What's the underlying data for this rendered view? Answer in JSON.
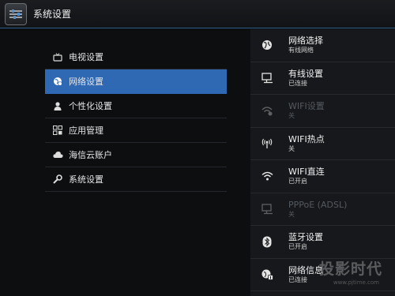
{
  "window": {
    "title": "系统设置",
    "icon": "settings-sliders-icon"
  },
  "menu": {
    "items": [
      {
        "label": "电视设置",
        "icon": "tv-icon"
      },
      {
        "label": "网络设置",
        "icon": "network-globe-icon",
        "active": true
      },
      {
        "label": "个性化设置",
        "icon": "person-icon"
      },
      {
        "label": "应用管理",
        "icon": "apps-grid-icon"
      },
      {
        "label": "海信云账户",
        "icon": "cloud-icon"
      },
      {
        "label": "系统设置",
        "icon": "wrench-icon"
      }
    ]
  },
  "network": {
    "items": [
      {
        "title": "网络选择",
        "status": "有线网络",
        "icon": "globe-icon",
        "enabled": true
      },
      {
        "title": "有线设置",
        "status": "已连接",
        "icon": "wired-monitor-icon",
        "enabled": true
      },
      {
        "title": "WIFI设置",
        "status": "关",
        "icon": "wifi-gear-icon",
        "enabled": false
      },
      {
        "title": "WIFI热点",
        "status": "关",
        "icon": "hotspot-icon",
        "enabled": true
      },
      {
        "title": "WIFI直连",
        "status": "已开启",
        "icon": "wifi-icon",
        "enabled": true
      },
      {
        "title": "PPPoE (ADSL)",
        "status": "关",
        "icon": "pppoe-monitor-icon",
        "enabled": false
      },
      {
        "title": "蓝牙设置",
        "status": "已开启",
        "icon": "bluetooth-icon",
        "enabled": true
      },
      {
        "title": "网络信息",
        "status": "已连接",
        "icon": "network-info-icon",
        "enabled": true
      }
    ]
  },
  "watermark": {
    "text": "投影时代",
    "url": "www.pjtime.com"
  },
  "colors": {
    "accent": "#2f68b3",
    "background": "#0c0e10",
    "panel": "#16181b"
  }
}
